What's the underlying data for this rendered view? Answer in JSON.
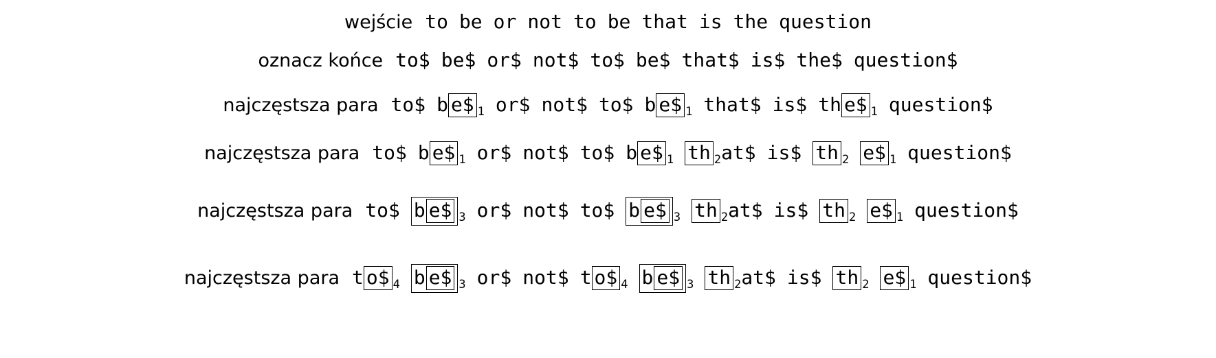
{
  "page": {
    "background_color": "#ffffff",
    "text_color": "#000000",
    "title": "BPE merge illustration"
  },
  "rows": [
    {
      "id": "row-input",
      "label": "wejście",
      "tokens": [
        {
          "text": "to"
        },
        {
          "text": "be"
        },
        {
          "text": "or"
        },
        {
          "text": "not"
        },
        {
          "text": "to"
        },
        {
          "text": "be"
        },
        {
          "text": "that"
        },
        {
          "text": "is"
        },
        {
          "text": "the"
        },
        {
          "text": "question"
        }
      ]
    },
    {
      "id": "row-mark-ends",
      "label": "oznacz końce",
      "tokens": [
        {
          "text": "to$"
        },
        {
          "text": "be$"
        },
        {
          "text": "or$"
        },
        {
          "text": "not$"
        },
        {
          "text": "to$"
        },
        {
          "text": "be$"
        },
        {
          "text": "that$"
        },
        {
          "text": "is$"
        },
        {
          "text": "the$"
        },
        {
          "text": "question$"
        }
      ]
    },
    {
      "id": "row-merge-1",
      "label": "najczęstsza para",
      "tokens": [
        {
          "text": "to$"
        },
        {
          "pre": "b",
          "box": {
            "text": "e$",
            "sub": "1"
          }
        },
        {
          "text": "or$"
        },
        {
          "text": "not$"
        },
        {
          "text": "to$"
        },
        {
          "pre": "b",
          "box": {
            "text": "e$",
            "sub": "1"
          }
        },
        {
          "text": "that$"
        },
        {
          "text": "is$"
        },
        {
          "pre": "th",
          "box": {
            "text": "e$",
            "sub": "1"
          }
        },
        {
          "text": "question$"
        }
      ]
    },
    {
      "id": "row-merge-2",
      "label": "najczęstsza para",
      "tokens": [
        {
          "text": "to$"
        },
        {
          "pre": "b",
          "box": {
            "text": "e$",
            "sub": "1"
          }
        },
        {
          "text": "or$"
        },
        {
          "text": "not$"
        },
        {
          "text": "to$"
        },
        {
          "pre": "b",
          "box": {
            "text": "e$",
            "sub": "1"
          }
        },
        {
          "box": {
            "text": "th",
            "sub": "2"
          },
          "post": "at$"
        },
        {
          "text": "is$"
        },
        {
          "box": {
            "text": "th",
            "sub": "2"
          }
        },
        {
          "box": {
            "text": "e$",
            "sub": "1"
          }
        },
        {
          "text": "question$"
        }
      ]
    },
    {
      "id": "row-merge-3",
      "label": "najczęstsza para",
      "tokens": [
        {
          "text": "to$"
        },
        {
          "outer": {
            "sub": "3",
            "pre": "b",
            "inner": {
              "text": "e$"
            }
          }
        },
        {
          "text": "or$"
        },
        {
          "text": "not$"
        },
        {
          "text": "to$"
        },
        {
          "outer": {
            "sub": "3",
            "pre": "b",
            "inner": {
              "text": "e$"
            }
          }
        },
        {
          "box": {
            "text": "th",
            "sub": "2"
          },
          "post": "at$"
        },
        {
          "text": "is$"
        },
        {
          "box": {
            "text": "th",
            "sub": "2"
          }
        },
        {
          "box": {
            "text": "e$",
            "sub": "1"
          }
        },
        {
          "text": "question$"
        }
      ]
    },
    {
      "id": "row-merge-4",
      "label": "najczęstsza para",
      "tokens": [
        {
          "pre": "t",
          "box": {
            "text": "o$",
            "sub": "4"
          }
        },
        {
          "outer": {
            "sub": "3",
            "pre": "b",
            "inner": {
              "text": "e$"
            }
          }
        },
        {
          "text": "or$"
        },
        {
          "text": "not$"
        },
        {
          "pre": "t",
          "box": {
            "text": "o$",
            "sub": "4"
          }
        },
        {
          "outer": {
            "sub": "3",
            "pre": "b",
            "inner": {
              "text": "e$"
            }
          }
        },
        {
          "box": {
            "text": "th",
            "sub": "2"
          },
          "post": "at$"
        },
        {
          "text": "is$"
        },
        {
          "box": {
            "text": "th",
            "sub": "2"
          }
        },
        {
          "box": {
            "text": "e$",
            "sub": "1"
          }
        },
        {
          "text": "question$"
        }
      ]
    }
  ]
}
